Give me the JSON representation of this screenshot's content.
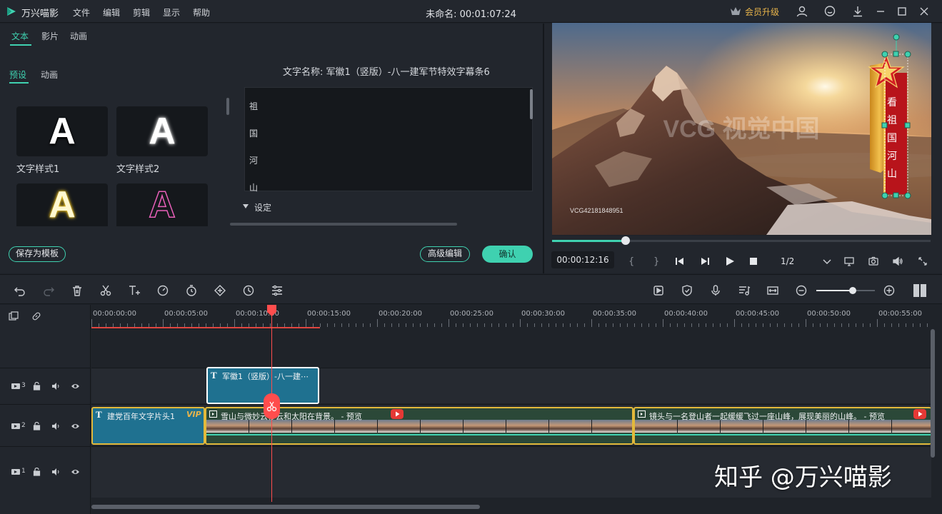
{
  "app": {
    "name": "万兴喵影",
    "menu": [
      "文件",
      "编辑",
      "剪辑",
      "显示",
      "帮助"
    ],
    "project_title": "未命名: 00:01:07:24",
    "vip_label": "会员升级"
  },
  "left_panel": {
    "main_tabs": [
      "文本",
      "影片",
      "动画"
    ],
    "sub_tabs": [
      "预设",
      "动画"
    ],
    "presets": [
      "文字样式1",
      "文字样式2"
    ],
    "preset_glyph": "A",
    "text_name_label": "文字名称: 军徽1（竖版）-八一建军节特效字幕条6",
    "text_lines": [
      "祖",
      "国",
      "河",
      "山"
    ],
    "settings_label": "设定",
    "save_template": "保存为模板",
    "advanced_edit": "高级编辑",
    "confirm": "确认"
  },
  "preview": {
    "watermark": "VCG 视觉中国",
    "image_id": "VCG42181848951",
    "vertical_text": [
      "看",
      "祖",
      "国",
      "河",
      "山"
    ],
    "timecode": "00:00:12:16",
    "page": "1/2",
    "progress": 0.194
  },
  "timeline": {
    "ruler": [
      "00:00:00:00",
      "00:00:05:00",
      "00:00:10:00",
      "00:00:15:00",
      "00:00:20:00",
      "00:00:25:00",
      "00:00:30:00",
      "00:00:35:00",
      "00:00:40:00",
      "00:00:45:00",
      "00:00:50:00",
      "00:00:55:00"
    ],
    "tracks": [
      {
        "id": "3"
      },
      {
        "id": "2"
      },
      {
        "id": "1"
      }
    ],
    "clips": {
      "text_clip_track3": "军徽1（竖版）-八一建⋯",
      "text_clip_track2": "建党百年文字片头1",
      "vip_badge": "VIP",
      "video_clip_1": "雪山与微妙云移云和太阳在背景。 - 预览",
      "video_clip_2": "镜头与一名登山者一起缓缓飞过一座山峰，展现美丽的山峰。 - 预览"
    },
    "zoom_level": 0.62
  },
  "overlay_watermark": "知乎 @万兴喵影",
  "colors": {
    "accent": "#3fd1b0",
    "playhead": "#ff4d4d",
    "text_clip": "#1f7190",
    "video_clip_border": "#e2b93b",
    "vip": "#e8b44a"
  }
}
